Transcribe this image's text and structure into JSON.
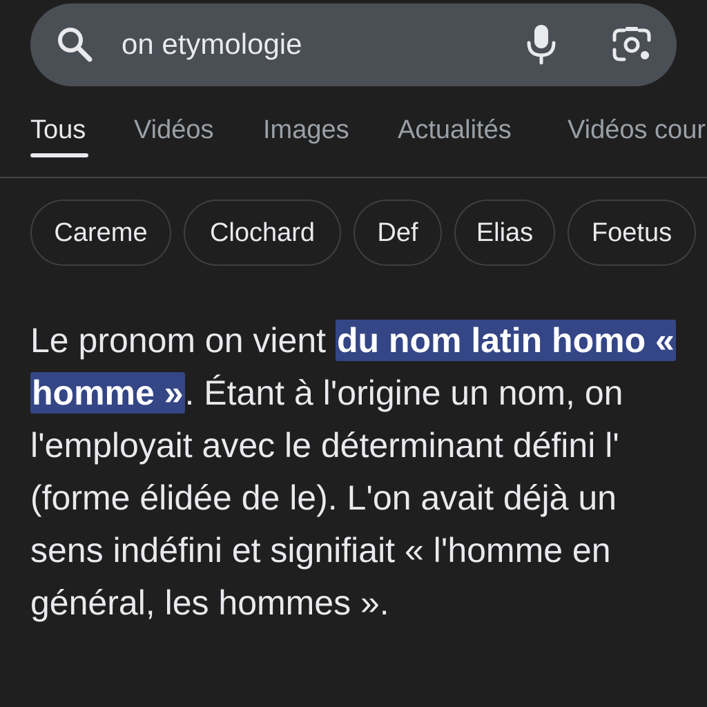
{
  "search": {
    "query": "on etymologie",
    "icons": {
      "search": "search-icon",
      "voice": "microphone-icon",
      "lens": "camera-lens-icon"
    }
  },
  "tabs": [
    {
      "label": "Tous",
      "active": true
    },
    {
      "label": "Vidéos",
      "active": false
    },
    {
      "label": "Images",
      "active": false
    },
    {
      "label": "Actualités",
      "active": false
    },
    {
      "label": "Vidéos cour",
      "active": false
    }
  ],
  "chips": [
    "Careme",
    "Clochard",
    "Def",
    "Elias",
    "Foetus"
  ],
  "answer": {
    "part1": "Le pronom on vient ",
    "highlight": "du nom latin homo « homme »",
    "part2": ". Étant à l'origine un nom, on l'employait avec le déterminant défini l' (forme élidée de le). L'on avait déjà un sens indéfini et signifiait « l'homme en général, les hommes »."
  },
  "colors": {
    "background": "#1f1f1f",
    "search_bar": "#4a4e55",
    "highlight": "#344686",
    "text": "#e8eaed",
    "muted_text": "#9aa0a6"
  }
}
